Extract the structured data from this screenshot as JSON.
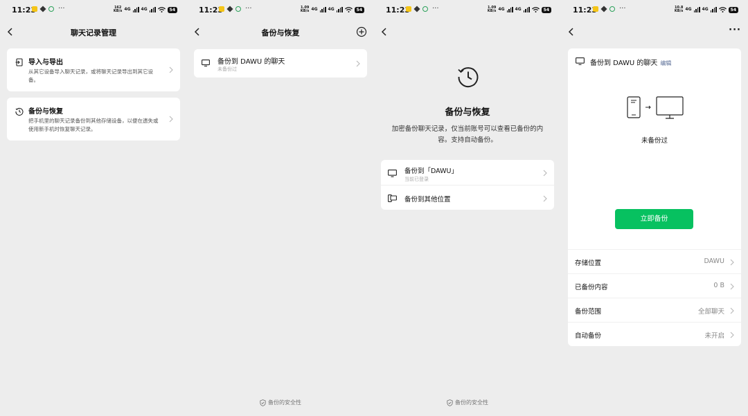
{
  "status_bar": {
    "time": "11:23",
    "battery": "54",
    "network": "4G",
    "screens": [
      {
        "speed_top": "162",
        "speed_unit": "KB/s"
      },
      {
        "speed_top": "1.09",
        "speed_unit": "KB/s"
      },
      {
        "speed_top": "1.09",
        "speed_unit": "KB/s"
      },
      {
        "speed_top": "10.8",
        "speed_unit": "KB/s"
      }
    ]
  },
  "screen1": {
    "title": "聊天记录管理",
    "items": [
      {
        "title": "导入与导出",
        "desc": "从其它设备导入聊天记录，或将聊天记录导出到其它设备。"
      },
      {
        "title": "备份与恢复",
        "desc": "把手机里的聊天记录备份到其他存储设备，以便在遗失或使用新手机时恢复聊天记录。"
      }
    ]
  },
  "screen2": {
    "title": "备份与恢复",
    "row_title": "备份到 DAWU 的聊天",
    "row_sub": "未备份过",
    "footer": "备份的安全性"
  },
  "screen3": {
    "heading": "备份与恢复",
    "desc": "加密备份聊天记录，仅当前账号可以查看已备份的内容。支持自动备份。",
    "options": [
      {
        "title": "备份到「DAWU」",
        "sub": "当前已登录"
      },
      {
        "title": "备份到其他位置"
      }
    ],
    "footer": "备份的安全性"
  },
  "screen4": {
    "header_title": "备份到 DAWU 的聊天",
    "edit": "编辑",
    "status": "未备份过",
    "button": "立即备份",
    "settings": [
      {
        "label": "存储位置",
        "value": "DAWU"
      },
      {
        "label": "已备份内容",
        "value": "0 B"
      },
      {
        "label": "备份范围",
        "value": "全部聊天"
      },
      {
        "label": "自动备份",
        "value": "未开启"
      }
    ]
  },
  "colors": {
    "accent": "#07c160",
    "link": "#576b95",
    "background": "#ededed"
  },
  "icons": [
    "back-arrow-icon",
    "add-circle-icon",
    "more-icon",
    "import-export-icon",
    "history-icon",
    "monitor-icon",
    "phone-monitor-icon",
    "chevron-right-icon",
    "shield-icon",
    "clock-restore-icon"
  ]
}
